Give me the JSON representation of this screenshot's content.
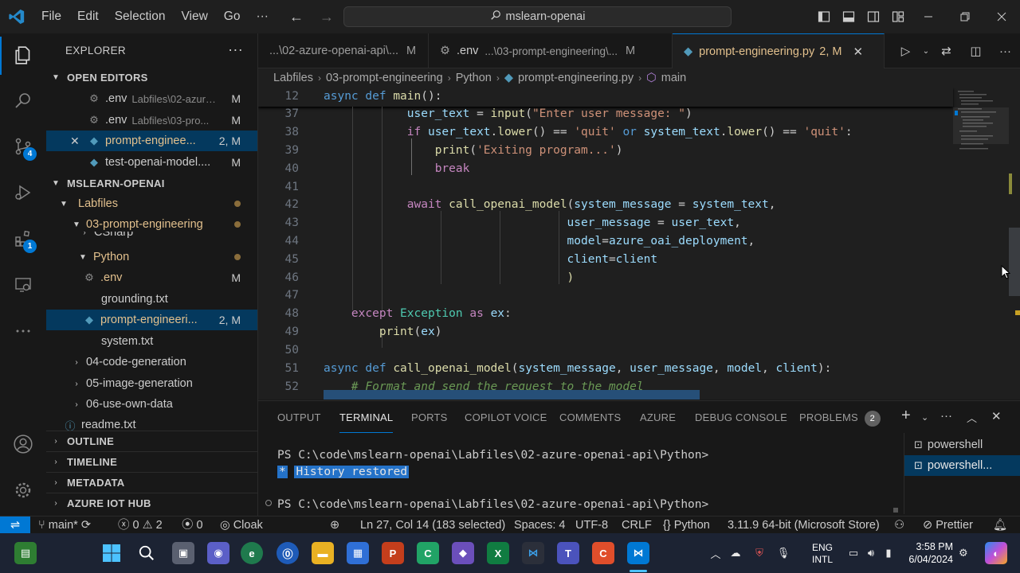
{
  "titlebar": {
    "menu": [
      "File",
      "Edit",
      "Selection",
      "View",
      "Go"
    ],
    "more": "···",
    "search": "mslearn-openai",
    "icons": [
      "vscode-logo-icon",
      "back-arrow-icon",
      "forward-arrow-icon",
      "toggle-primary-sidebar-icon",
      "toggle-panel-icon",
      "toggle-secondary-sidebar-icon",
      "customize-layout-icon",
      "minimize-icon",
      "restore-icon",
      "close-icon"
    ]
  },
  "activitybar": {
    "source_control_badge": "4",
    "extensions_badge": "1"
  },
  "sidebar": {
    "title": "EXPLORER",
    "open_editors_header": "OPEN EDITORS",
    "open_editors": [
      {
        "name": ".env",
        "path": "Labfiles\\02-azure-openai...",
        "flag": "M"
      },
      {
        "name": ".env",
        "path": "Labfiles\\03-pro...",
        "flag": "M"
      },
      {
        "name": "prompt-enginee...",
        "path": "",
        "flag": "2, M"
      },
      {
        "name": "test-openai-model....",
        "path": "",
        "flag": "M"
      }
    ],
    "workspace_header": "MSLEARN-OPENAI",
    "tree": {
      "labfiles": "Labfiles",
      "prompt_engineering": "03-prompt-engineering",
      "csharp": "CSharp",
      "python": "Python",
      "env": ".env",
      "env_flag": "M",
      "grounding": "grounding.txt",
      "prompt_py": "prompt-engineeri...",
      "prompt_py_flag": "2, M",
      "system": "system.txt",
      "code_gen": "04-code-generation",
      "image_gen": "05-image-generation",
      "own_data": "06-use-own-data",
      "readme": "readme.txt"
    },
    "outline": "OUTLINE",
    "timeline": "TIMELINE",
    "metadata": "METADATA",
    "azure_iot": "AZURE IOT HUB"
  },
  "tabs": [
    {
      "label": "...\\02-azure-openai-api\\...",
      "flag": "M"
    },
    {
      "label": ".env",
      "path": "...\\03-prompt-engineering\\...",
      "flag": "M"
    },
    {
      "label": "prompt-engineering.py",
      "flag": "2, M",
      "close": "✕"
    }
  ],
  "breadcrumbs": [
    "Labfiles",
    "03-prompt-engineering",
    "Python",
    "prompt-engineering.py",
    "main"
  ],
  "editor": {
    "sticky": {
      "ln": "12",
      "kw": "async def ",
      "fn": "main",
      "rest": "():"
    },
    "line_numbers": [
      "37",
      "38",
      "39",
      "40",
      "41",
      "42",
      "43",
      "44",
      "45",
      "46",
      "47",
      "48",
      "49",
      "50",
      "51",
      "52"
    ]
  },
  "panel": {
    "tabs": [
      "OUTPUT",
      "TERMINAL",
      "PORTS",
      "COPILOT VOICE",
      "COMMENTS",
      "AZURE",
      "DEBUG CONSOLE",
      "PROBLEMS"
    ],
    "problems_count": "2",
    "terminal_lines": [
      "PS C:\\code\\mslearn-openai\\Labfiles\\02-azure-openai-api\\Python>",
      "PS C:\\code\\mslearn-openai\\Labfiles\\02-azure-openai-api\\Python>"
    ],
    "history_star": "*",
    "history_text": "History restored",
    "terminals": [
      "powershell",
      "powershell..."
    ]
  },
  "statusbar": {
    "branch": "main*",
    "errors": "0",
    "warnings": "2",
    "ports": "0",
    "cloak": "Cloak",
    "position": "Ln 27, Col 14 (183 selected)",
    "spaces": "Spaces: 4",
    "encoding": "UTF-8",
    "eol": "CRLF",
    "language": "Python",
    "interpreter": "3.11.9 64-bit (Microsoft Store)",
    "prettier": "Prettier"
  },
  "taskbar": {
    "lang": "ENG",
    "region": "INTL",
    "time": "3:58 PM",
    "date": "6/04/2024"
  },
  "colors": {
    "accent": "#0078d4",
    "modified": "#e2c08d",
    "keyword": "#569cd6",
    "function": "#dcdcaa",
    "string": "#ce9178",
    "variable": "#9cdcfe"
  }
}
